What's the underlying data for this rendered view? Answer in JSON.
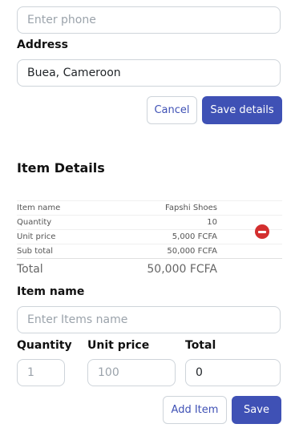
{
  "contact": {
    "phone": {
      "value": "",
      "placeholder": "Enter phone"
    },
    "address_label": "Address",
    "address": {
      "value": "Buea, Cameroon",
      "placeholder": ""
    },
    "cancel_label": "Cancel",
    "save_details_label": "Save details"
  },
  "items": {
    "title": "Item Details",
    "summary": [
      {
        "label": "Item name",
        "value": "Fapshi Shoes"
      },
      {
        "label": "Quantity",
        "value": "10"
      },
      {
        "label": "Unit price",
        "value": "5,000 FCFA"
      },
      {
        "label": "Sub total",
        "value": "50,000 FCFA"
      }
    ],
    "total_label": "Total",
    "total_value": "50,000 FCFA"
  },
  "item_form": {
    "item_name_label": "Item name",
    "item_name": {
      "value": "",
      "placeholder": "Enter Items name"
    },
    "quantity_label": "Quantity",
    "quantity": {
      "value": "",
      "placeholder": "1"
    },
    "unit_price_label": "Unit price",
    "unit_price": {
      "value": "",
      "placeholder": "100"
    },
    "total_label": "Total",
    "total": {
      "value": "0",
      "placeholder": ""
    },
    "add_item_label": "Add Item",
    "save_label": "Save"
  },
  "colors": {
    "primary": "#3f51b5",
    "danger": "#d32f2f",
    "border": "#ced4da"
  },
  "icons": {
    "remove": "remove-circle-icon"
  }
}
